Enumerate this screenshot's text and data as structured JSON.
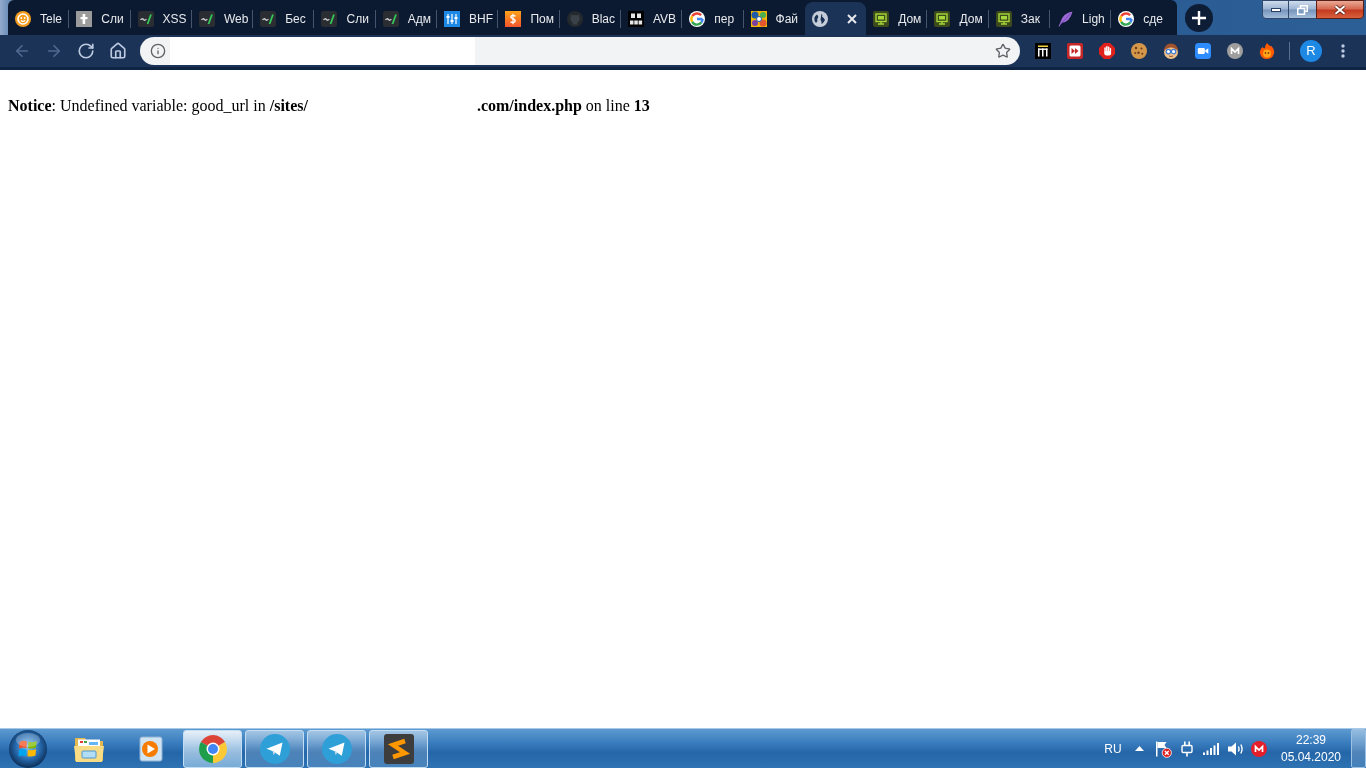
{
  "browser": {
    "tabs": [
      {
        "title": "Tele",
        "selected": false
      },
      {
        "title": "Сли",
        "selected": false
      },
      {
        "title": "XSS",
        "selected": false
      },
      {
        "title": "Web",
        "selected": false
      },
      {
        "title": "Бес",
        "selected": false
      },
      {
        "title": "Сли",
        "selected": false
      },
      {
        "title": "Адм",
        "selected": false
      },
      {
        "title": "BHF",
        "selected": false
      },
      {
        "title": "Пом",
        "selected": false
      },
      {
        "title": "Blac",
        "selected": false
      },
      {
        "title": "AVB",
        "selected": false
      },
      {
        "title": "пер",
        "selected": false
      },
      {
        "title": "Фай",
        "selected": false
      },
      {
        "selected": true
      },
      {
        "title": "Дом",
        "selected": false
      },
      {
        "title": "Дом",
        "selected": false
      },
      {
        "title": "Зак",
        "selected": false
      },
      {
        "title": "Ligh",
        "selected": false
      },
      {
        "title": "сде",
        "selected": false
      }
    ],
    "toolbar": {
      "nav_buttons": [
        {
          "disabled": true
        },
        {
          "disabled": true
        },
        {
          "disabled": false
        },
        {
          "disabled": false
        }
      ]
    },
    "profile": {
      "initial": "R"
    }
  },
  "page": {
    "notice": {
      "parts": [
        "**Notice**: Undefined variable: good_url in **/sites/**",
        "**.com/index.php** on line **13**"
      ]
    }
  },
  "taskbar": {
    "apps": [
      {
        "running": false,
        "selected": false
      },
      {
        "running": false,
        "selected": false
      },
      {
        "running": true,
        "selected": true
      },
      {
        "running": true,
        "selected": false
      },
      {
        "running": true,
        "selected": false
      },
      {
        "running": true,
        "selected": false
      }
    ],
    "tray": {
      "language": "RU",
      "time": "22:39",
      "date": "05.04.2020"
    }
  }
}
